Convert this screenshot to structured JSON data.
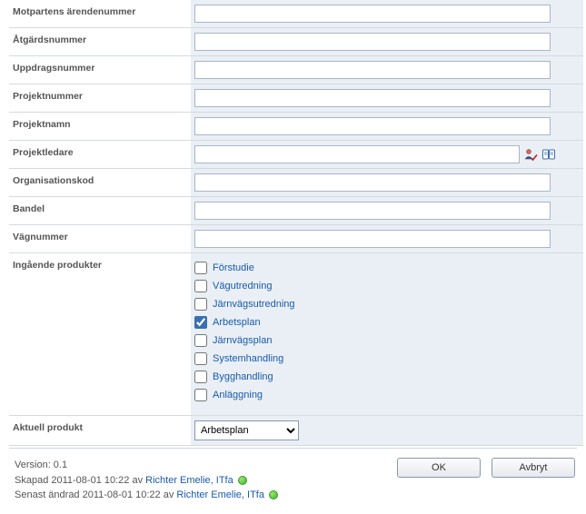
{
  "fields": {
    "motpartens": {
      "label": "Motpartens ärendenummer",
      "value": ""
    },
    "atgard": {
      "label": "Åtgärdsnummer",
      "value": ""
    },
    "uppdrag": {
      "label": "Uppdragsnummer",
      "value": ""
    },
    "projektnummer": {
      "label": "Projektnummer",
      "value": ""
    },
    "projektnamn": {
      "label": "Projektnamn",
      "value": ""
    },
    "projektledare": {
      "label": "Projektledare",
      "value": ""
    },
    "organisationskod": {
      "label": "Organisationskod",
      "value": ""
    },
    "bandel": {
      "label": "Bandel",
      "value": ""
    },
    "vagnummer": {
      "label": "Vägnummer",
      "value": ""
    }
  },
  "produkter": {
    "label": "Ingående produkter",
    "items": [
      {
        "label": "Förstudie",
        "checked": false
      },
      {
        "label": "Vägutredning",
        "checked": false
      },
      {
        "label": "Järnvägsutredning",
        "checked": false
      },
      {
        "label": "Arbetsplan",
        "checked": true
      },
      {
        "label": "Järnvägsplan",
        "checked": false
      },
      {
        "label": "Systemhandling",
        "checked": false
      },
      {
        "label": "Bygghandling",
        "checked": false
      },
      {
        "label": "Anläggning",
        "checked": false
      }
    ]
  },
  "aktuell": {
    "label": "Aktuell produkt",
    "selected": "Arbetsplan"
  },
  "meta": {
    "version_label": "Version: 0.1",
    "created_prefix": "Skapad 2011-08-01 10:22  av ",
    "created_user": "Richter Emelie, ITfa",
    "modified_prefix": "Senast ändrad 2011-08-01 10:22  av ",
    "modified_user": "Richter Emelie, ITfa"
  },
  "buttons": {
    "ok": "OK",
    "cancel": "Avbryt"
  },
  "icons": {
    "person_check": "person-check-icon",
    "book": "book-icon"
  }
}
